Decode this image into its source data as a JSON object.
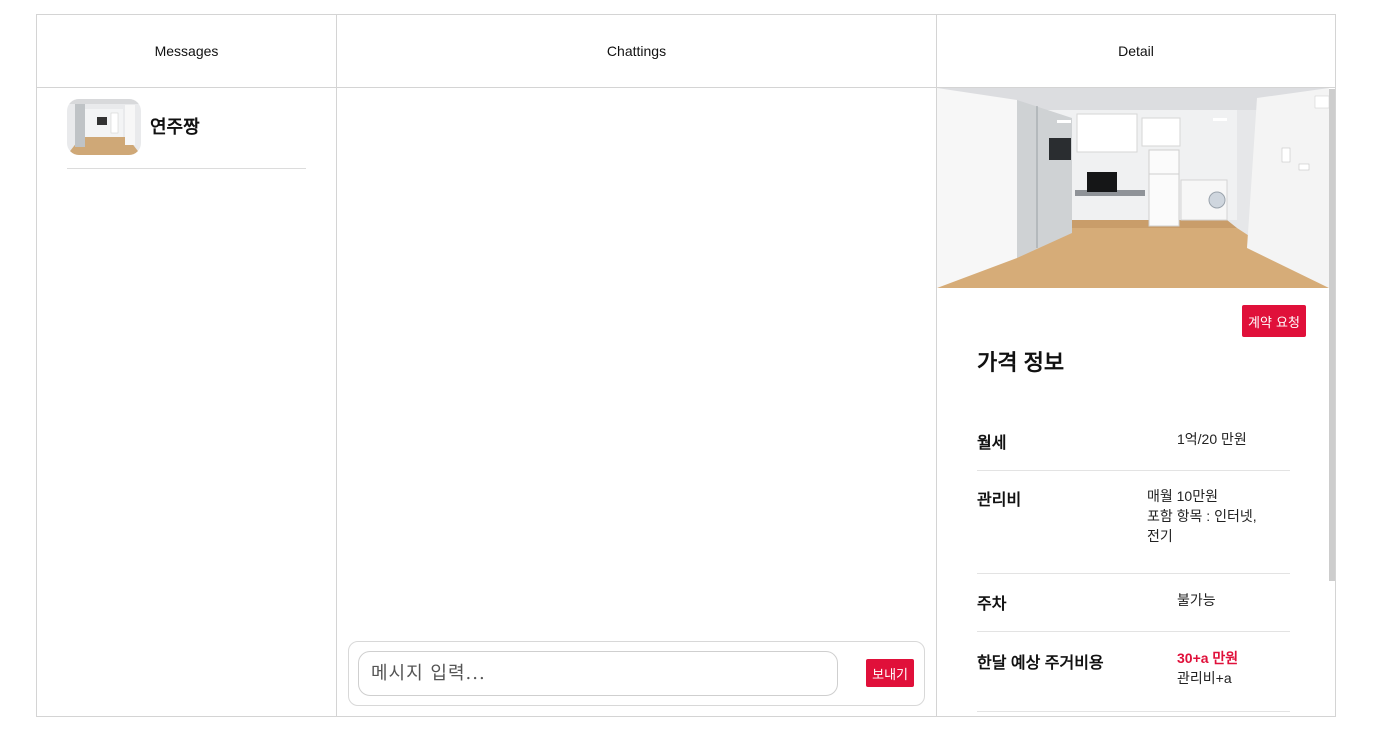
{
  "columns": {
    "messages": "Messages",
    "chattings": "Chattings",
    "detail": "Detail"
  },
  "messages": [
    {
      "name": "연주짱",
      "avatar_icon": "room-photo-thumbnail"
    }
  ],
  "chat": {
    "input_placeholder": "메시지 입력...",
    "input_value": "",
    "send_label": "보내기"
  },
  "detail": {
    "photo_icon": "room-interior-photo",
    "contract_label": "계약 요청",
    "price_title": "가격 정보",
    "rows": [
      {
        "label": "월세",
        "value_lines": [
          "1억/20 만원"
        ]
      },
      {
        "label": "관리비",
        "value_lines": [
          "매월 10만원",
          "포함 항목 : 인터넷,",
          "전기"
        ]
      },
      {
        "label": "주차",
        "value_lines": [
          "불가능"
        ]
      },
      {
        "label": "한달 예상 주거비용",
        "value_lines": [
          "30+a 만원",
          "관리비+a"
        ]
      }
    ]
  },
  "colors": {
    "accent": "#e0103a",
    "border": "#d4d4d4"
  }
}
